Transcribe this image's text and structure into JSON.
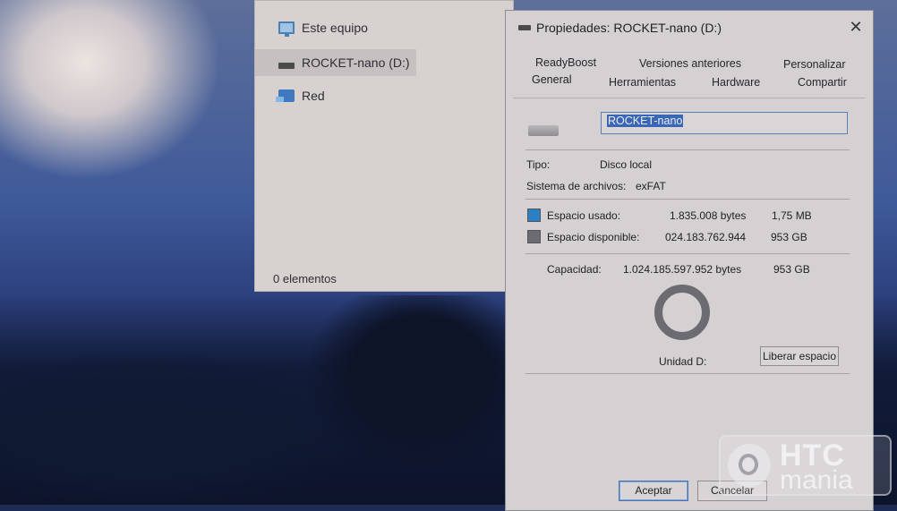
{
  "explorer": {
    "nav": [
      {
        "label": "Este equipo",
        "icon": "computer-icon"
      },
      {
        "label": "ROCKET-nano (D:)",
        "icon": "drive-icon",
        "selected": true
      },
      {
        "label": "Red",
        "icon": "network-icon"
      }
    ],
    "status": "0 elementos"
  },
  "dialog": {
    "title": "Propiedades: ROCKET-nano (D:)",
    "tabs_row1": [
      "ReadyBoost",
      "Versiones anteriores",
      "Personalizar"
    ],
    "tabs_row2": [
      "General",
      "Herramientas",
      "Hardware",
      "Compartir"
    ],
    "active_tab": "General",
    "volume_name": "ROCKET-nano",
    "type_label": "Tipo:",
    "type_value": "Disco local",
    "fs_label": "Sistema de archivos:",
    "fs_value": "exFAT",
    "used": {
      "label": "Espacio usado:",
      "bytes": "1.835.008 bytes",
      "size": "1,75 MB",
      "color": "#2b7fc3"
    },
    "free": {
      "label": "Espacio disponible:",
      "bytes": "024.183.762.944",
      "size": "953 GB",
      "color": "#6d6b72"
    },
    "capacity": {
      "label": "Capacidad:",
      "bytes": "1.024.185.597.952 bytes",
      "size": "953 GB"
    },
    "drive_label": "Unidad D:",
    "cleanup_button": "Liberar espacio",
    "ok_button": "Aceptar",
    "cancel_button": "Cancelar",
    "close_glyph": "✕"
  },
  "watermark": {
    "line1": "HTC",
    "line2": "mania"
  }
}
